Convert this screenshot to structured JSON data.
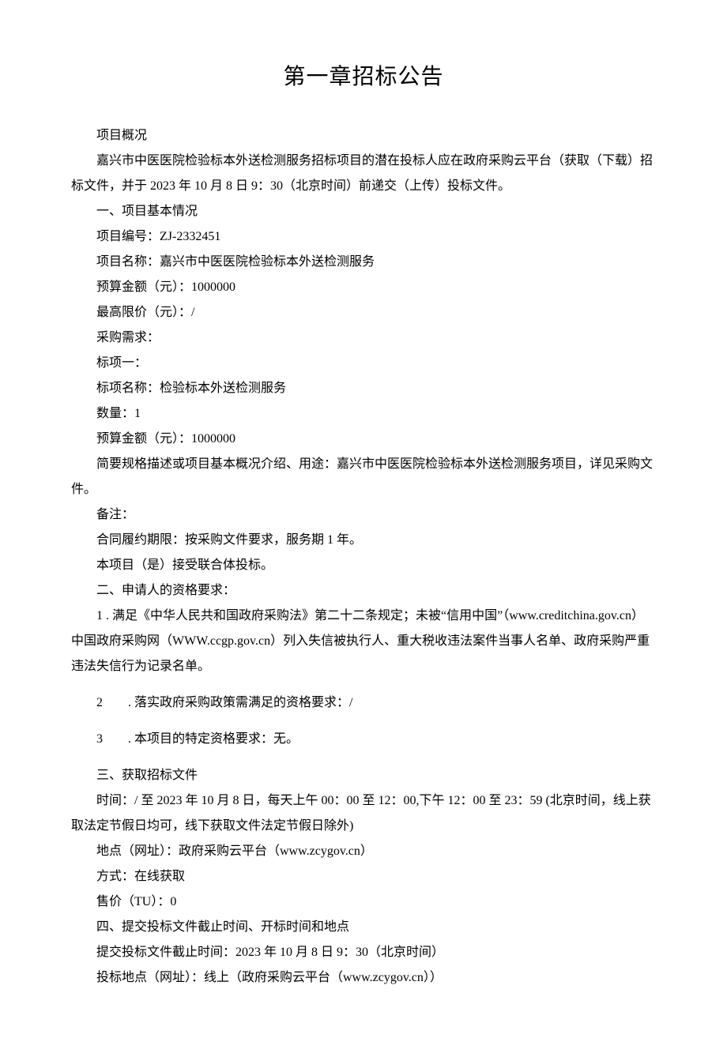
{
  "title": "第一章招标公告",
  "lines": {
    "l1": "项目概况",
    "l2": "嘉兴市中医医院检验标本外送检测服务招标项目的潜在投标人应在政府采购云平台（获取（下载）招标文件，并于 2023 年 10 月 8 日 9：30（北京时间）前递交（上传）投标文件。",
    "l3": "一、项目基本情况",
    "l4": "项目编号：ZJ-2332451",
    "l5": "项目名称：嘉兴市中医医院检验标本外送检测服务",
    "l6": "预算金额（元）：1000000",
    "l7": "最高限价（元）：/",
    "l8": "采购需求：",
    "l9": "标项一：",
    "l10": "标项名称：检验标本外送检测服务",
    "l11": "数量：1",
    "l12": "预算金额（元）：1000000",
    "l13": "简要规格描述或项目基本概况介绍、用途：嘉兴市中医医院检验标本外送检测服务项目，详见采购文件。",
    "l14": "备注：",
    "l15": "合同履约期限：按采购文件要求，服务期 1 年。",
    "l16": "本项目（是）接受联合体投标。",
    "l17": "二、申请人的资格要求：",
    "l18": "1 . 满足《中华人民共和国政府采购法》第二十二条规定；未被“信用中国”（www.creditchina.gov.cn）中国政府采购网（WWW.ccgp.gov.cn）列入失信被执行人、重大税收违法案件当事人名单、政府采购严重违法失信行为记录名单。",
    "l19": "2  . 落实政府采购政策需满足的资格要求：/",
    "l20": "3  . 本项目的特定资格要求：无。",
    "l21": "三、获取招标文件",
    "l22": "时间：/ 至 2023 年 10 月 8 日，每天上午 00：00 至 12：00,下午 12：00 至 23：59 (北京时间，线上获取法定节假日均可，线下获取文件法定节假日除外)",
    "l23": "地点（网址）：政府采购云平台（www.zcygov.cn）",
    "l24": "方式：在线获取",
    "l25": "售价（TU）：0",
    "l26": "四、提交投标文件截止时间、开标时间和地点",
    "l27": "提交投标文件截止时间：2023 年 10 月 8 日 9：30（北京时间）",
    "l28": "投标地点（网址）：线上（政府采购云平台（www.zcygov.cn））"
  }
}
